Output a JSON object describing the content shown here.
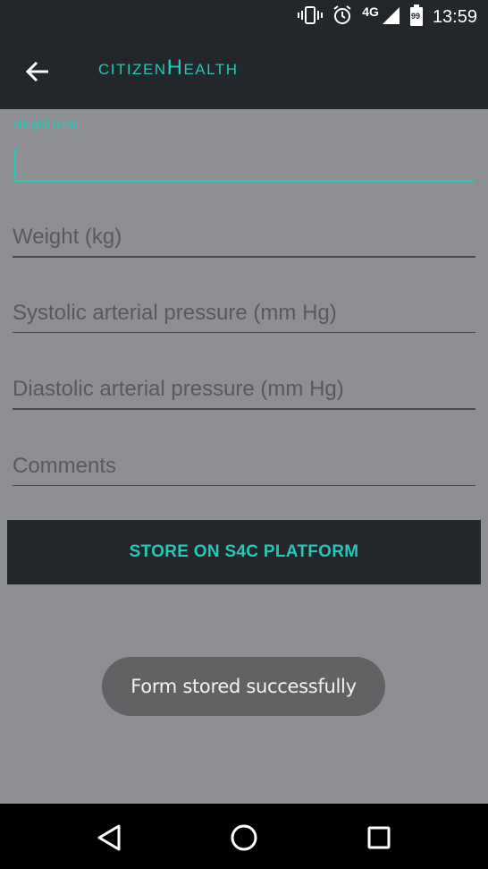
{
  "status_bar": {
    "network": "4G",
    "battery": "99",
    "time": "13:59",
    "icons": [
      "vibrate-icon",
      "alarm-icon",
      "signal-icon",
      "battery-icon"
    ]
  },
  "app_bar": {
    "title": "citizenHealth",
    "back_icon": "arrow-back-icon"
  },
  "form": {
    "height": {
      "label": "Height (cm)",
      "value": ""
    },
    "weight": {
      "placeholder": "Weight (kg)",
      "value": ""
    },
    "systolic": {
      "placeholder": "Systolic arterial pressure (mm Hg)",
      "value": ""
    },
    "diastolic": {
      "placeholder": "Diastolic arterial pressure (mm Hg)",
      "value": ""
    },
    "comments": {
      "placeholder": "Comments",
      "value": ""
    },
    "submit_label": "STORE ON S4C PLATFORM"
  },
  "toast": {
    "message": "Form stored successfully"
  },
  "nav_bar": {
    "icons": [
      "back-triangle-icon",
      "home-circle-icon",
      "recents-square-icon"
    ]
  },
  "colors": {
    "accent": "#26c6b8",
    "bar_background": "#23262b",
    "content_background": "#8e8f92",
    "toast_background": "#616264"
  }
}
